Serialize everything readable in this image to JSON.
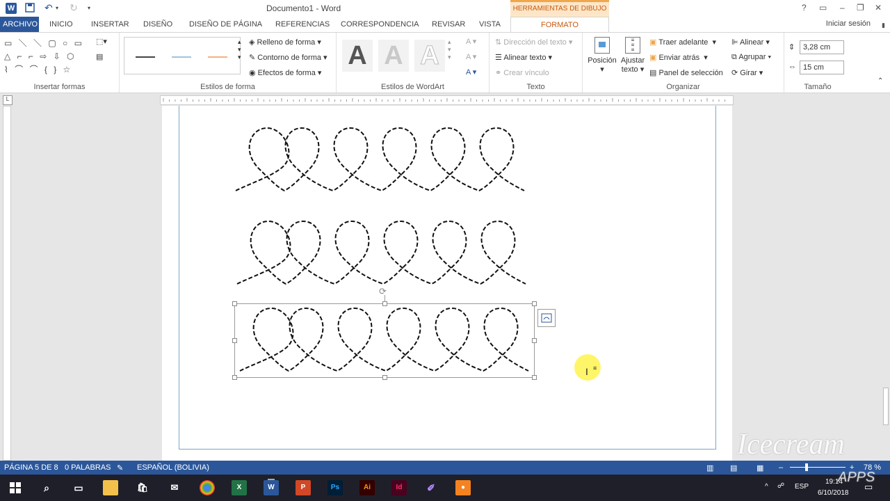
{
  "window": {
    "title": "Documento1 - Word",
    "context_header": "HERRAMIENTAS DE DIBUJO",
    "help": "?",
    "sign_in": "Iniciar sesión"
  },
  "tabs": [
    {
      "label": "ARCHIVO"
    },
    {
      "label": "INICIO"
    },
    {
      "label": "INSERTAR"
    },
    {
      "label": "DISEÑO"
    },
    {
      "label": "DISEÑO DE PÁGINA"
    },
    {
      "label": "REFERENCIAS"
    },
    {
      "label": "CORRESPONDENCIA"
    },
    {
      "label": "REVISAR"
    },
    {
      "label": "VISTA"
    },
    {
      "label": "FORMATO"
    }
  ],
  "ribbon": {
    "insert_shapes": {
      "label": "Insertar formas"
    },
    "shape_styles": {
      "label": "Estilos de forma",
      "fill": "Relleno de forma",
      "outline": "Contorno de forma",
      "effects": "Efectos de forma"
    },
    "wordart": {
      "label": "Estilos de WordArt",
      "letter": "A"
    },
    "text": {
      "label": "Texto",
      "direction": "Dirección del texto",
      "align": "Alinear texto",
      "link": "Crear vínculo"
    },
    "arrange": {
      "label": "Organizar",
      "position": "Posición",
      "wrap1": "Ajustar",
      "wrap2": "texto",
      "forward": "Traer adelante",
      "backward": "Enviar atrás",
      "pane": "Panel de selección",
      "align": "Alinear",
      "group": "Agrupar",
      "rotate": "Girar"
    },
    "size": {
      "label": "Tamaño",
      "height": "3,28 cm",
      "width": "15 cm"
    }
  },
  "status": {
    "page": "PÁGINA 5 DE 8",
    "words": "0 PALABRAS",
    "language": "ESPAÑOL (BOLIVIA)",
    "zoom": "78 %"
  },
  "taskbar": {
    "apps": [
      "X",
      "W",
      "P",
      "Ps",
      "Ai",
      "Id"
    ],
    "lang": "ESP",
    "time": "19:14",
    "date": "6/10/2018"
  },
  "watermark": {
    "brand": "Icecream",
    "sub": "APPS"
  },
  "colors": {
    "word_blue": "#2b579a",
    "format_orange": "#c55a11"
  }
}
